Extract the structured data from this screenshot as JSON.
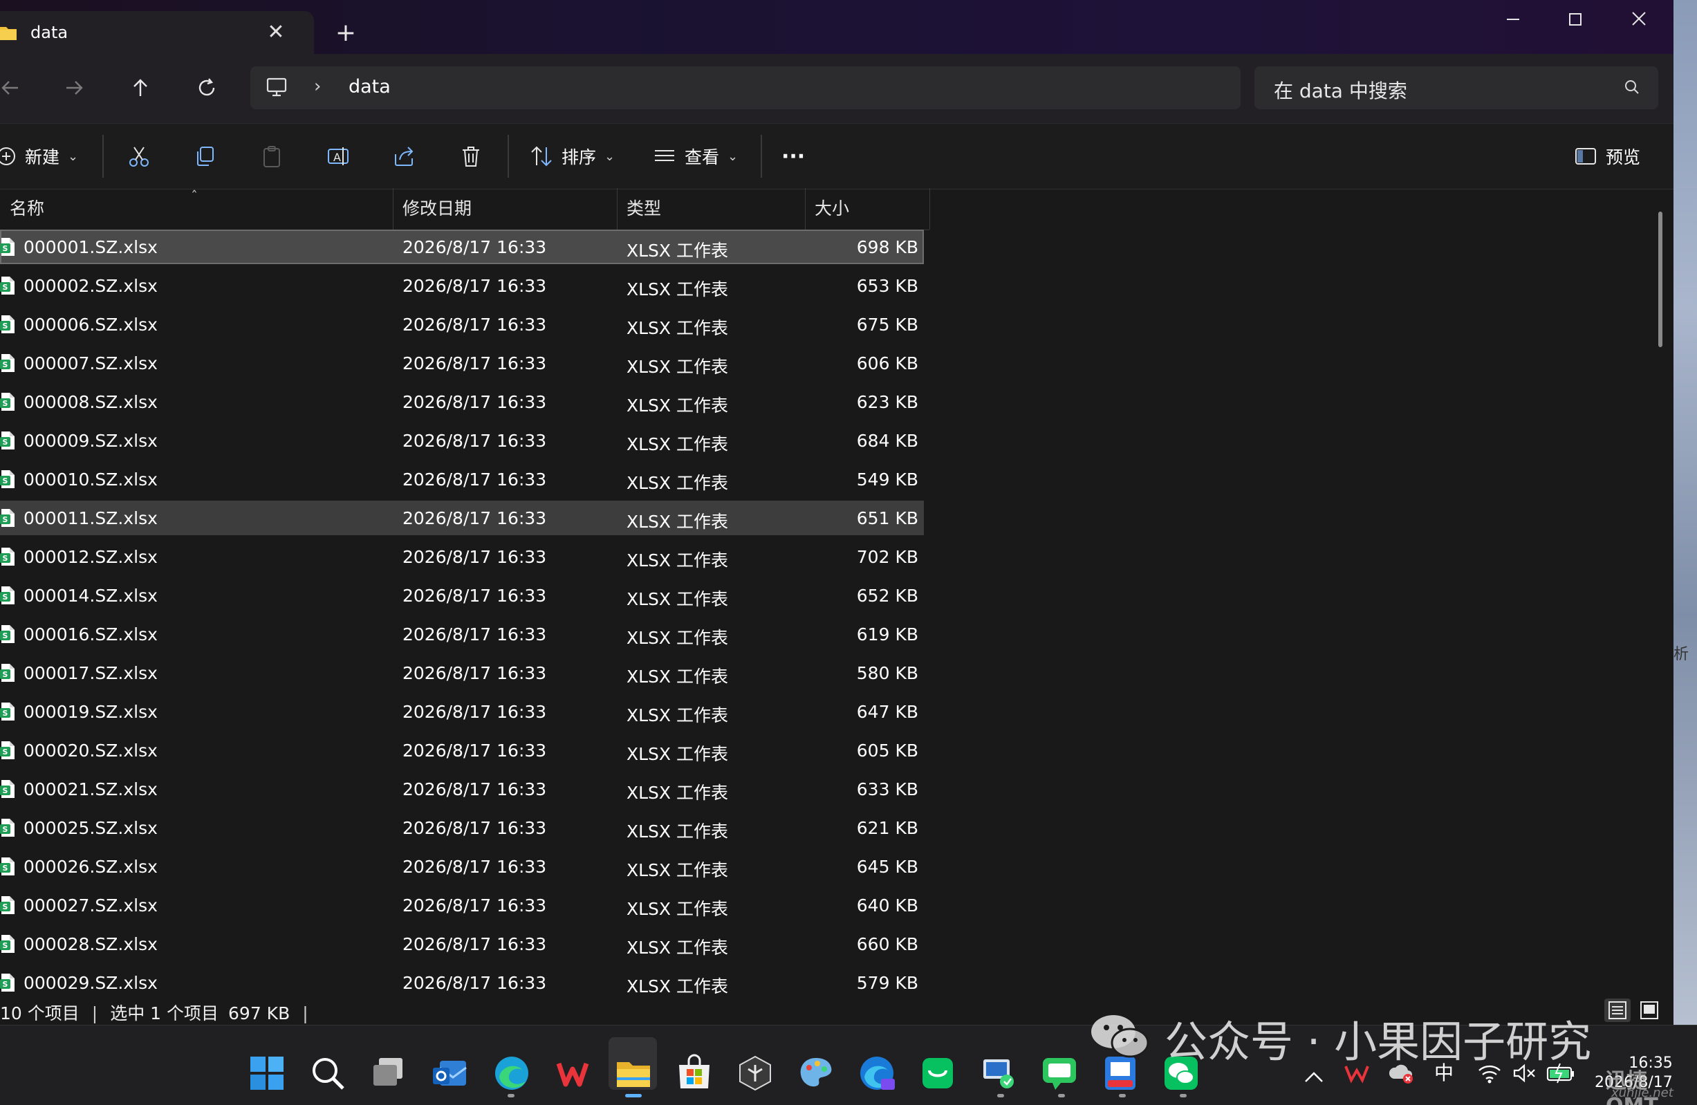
{
  "window": {
    "tab_title": "data",
    "new_tab": "+",
    "close_tab": "✕"
  },
  "nav": {
    "breadcrumb": [
      "data"
    ],
    "search_placeholder": "在 data 中搜索"
  },
  "toolbar": {
    "new_label": "新建",
    "sort_label": "排序",
    "view_label": "查看",
    "more_label": "···",
    "preview_label": "预览"
  },
  "columns": {
    "name": "名称",
    "modified": "修改日期",
    "type": "类型",
    "size": "大小"
  },
  "files": [
    {
      "name": "000001.SZ.xlsx",
      "date": "2026/8/17 16:33",
      "type": "XLSX 工作表",
      "size": "698 KB"
    },
    {
      "name": "000002.SZ.xlsx",
      "date": "2026/8/17 16:33",
      "type": "XLSX 工作表",
      "size": "653 KB"
    },
    {
      "name": "000006.SZ.xlsx",
      "date": "2026/8/17 16:33",
      "type": "XLSX 工作表",
      "size": "675 KB"
    },
    {
      "name": "000007.SZ.xlsx",
      "date": "2026/8/17 16:33",
      "type": "XLSX 工作表",
      "size": "606 KB"
    },
    {
      "name": "000008.SZ.xlsx",
      "date": "2026/8/17 16:33",
      "type": "XLSX 工作表",
      "size": "623 KB"
    },
    {
      "name": "000009.SZ.xlsx",
      "date": "2026/8/17 16:33",
      "type": "XLSX 工作表",
      "size": "684 KB"
    },
    {
      "name": "000010.SZ.xlsx",
      "date": "2026/8/17 16:33",
      "type": "XLSX 工作表",
      "size": "549 KB"
    },
    {
      "name": "000011.SZ.xlsx",
      "date": "2026/8/17 16:33",
      "type": "XLSX 工作表",
      "size": "651 KB"
    },
    {
      "name": "000012.SZ.xlsx",
      "date": "2026/8/17 16:33",
      "type": "XLSX 工作表",
      "size": "702 KB"
    },
    {
      "name": "000014.SZ.xlsx",
      "date": "2026/8/17 16:33",
      "type": "XLSX 工作表",
      "size": "652 KB"
    },
    {
      "name": "000016.SZ.xlsx",
      "date": "2026/8/17 16:33",
      "type": "XLSX 工作表",
      "size": "619 KB"
    },
    {
      "name": "000017.SZ.xlsx",
      "date": "2026/8/17 16:33",
      "type": "XLSX 工作表",
      "size": "580 KB"
    },
    {
      "name": "000019.SZ.xlsx",
      "date": "2026/8/17 16:33",
      "type": "XLSX 工作表",
      "size": "647 KB"
    },
    {
      "name": "000020.SZ.xlsx",
      "date": "2026/8/17 16:33",
      "type": "XLSX 工作表",
      "size": "605 KB"
    },
    {
      "name": "000021.SZ.xlsx",
      "date": "2026/8/17 16:33",
      "type": "XLSX 工作表",
      "size": "633 KB"
    },
    {
      "name": "000025.SZ.xlsx",
      "date": "2026/8/17 16:33",
      "type": "XLSX 工作表",
      "size": "621 KB"
    },
    {
      "name": "000026.SZ.xlsx",
      "date": "2026/8/17 16:33",
      "type": "XLSX 工作表",
      "size": "645 KB"
    },
    {
      "name": "000027.SZ.xlsx",
      "date": "2026/8/17 16:33",
      "type": "XLSX 工作表",
      "size": "640 KB"
    },
    {
      "name": "000028.SZ.xlsx",
      "date": "2026/8/17 16:33",
      "type": "XLSX 工作表",
      "size": "660 KB"
    },
    {
      "name": "000029.SZ.xlsx",
      "date": "2026/8/17 16:33",
      "type": "XLSX 工作表",
      "size": "579 KB"
    }
  ],
  "status": {
    "count": "10 个项目",
    "selection": "选中 1 个项目",
    "selection_size": "697 KB"
  },
  "edge_text": "析",
  "taskbar": {
    "ime": "中",
    "time": "16:35",
    "date": "2026/8/17"
  },
  "watermark": {
    "text": "公众号 · 小果因子研究",
    "brand": "迅捷OMT",
    "url": "xunjie.net"
  },
  "colors": {
    "excel_green": "#1f9d55",
    "selection": "#4a4a4a",
    "titlebar": "#1a1230"
  }
}
